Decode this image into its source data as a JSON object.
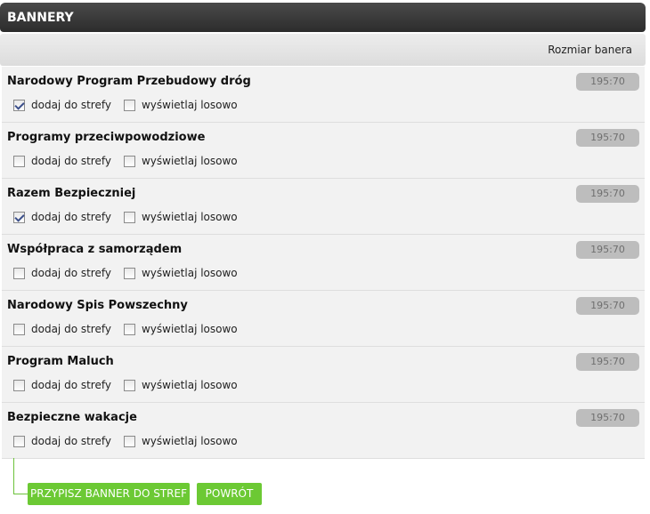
{
  "panel": {
    "title": "BANNERY",
    "column_header": "Rozmiar banera"
  },
  "labels": {
    "add_to_zones": "dodaj do strefy",
    "show_random": "wyświetlaj losowo"
  },
  "banners": [
    {
      "name": "Narodowy Program Przebudowy dróg",
      "size": "195:70",
      "add_to_zones": true,
      "show_random": false
    },
    {
      "name": "Programy przeciwpowodziowe",
      "size": "195:70",
      "add_to_zones": false,
      "show_random": false
    },
    {
      "name": "Razem Bezpieczniej",
      "size": "195:70",
      "add_to_zones": true,
      "show_random": false
    },
    {
      "name": "Współpraca z samorządem",
      "size": "195:70",
      "add_to_zones": false,
      "show_random": false
    },
    {
      "name": "Narodowy Spis Powszechny",
      "size": "195:70",
      "add_to_zones": false,
      "show_random": false
    },
    {
      "name": "Program Maluch",
      "size": "195:70",
      "add_to_zones": false,
      "show_random": false
    },
    {
      "name": "Bezpieczne wakacje",
      "size": "195:70",
      "add_to_zones": false,
      "show_random": false
    }
  ],
  "buttons": {
    "assign": "PRZYPISZ BANNER DO STREF",
    "back": "POWRÓT"
  },
  "colors": {
    "title_bar": "#333333",
    "button_green": "#6cc934",
    "size_badge": "#bdbdbd"
  }
}
